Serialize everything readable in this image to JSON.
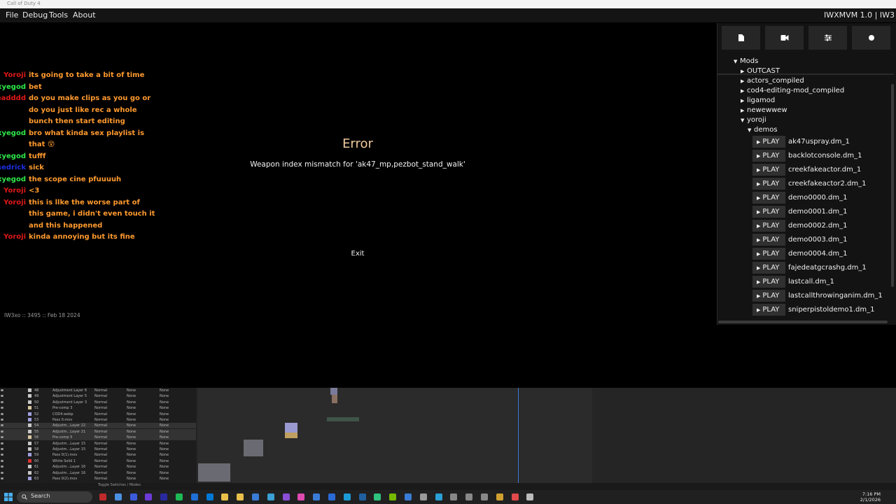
{
  "window": {
    "title": "Call of Duty 4"
  },
  "menu": {
    "file": "File",
    "debug": "Debug",
    "tools": "Tools",
    "about": "About",
    "version": "IWXMVM 1.0 | IW3"
  },
  "chat": [
    {
      "name": "Yoroji",
      "name_color": "#e01818",
      "text": "its going to take a bit of time"
    },
    {
      "name": "oxyegod",
      "name_color": "#2ee84a",
      "text": "bet"
    },
    {
      "name": "eadddd",
      "name_color": "#e01818",
      "text": "do you make clips as you go or"
    },
    {
      "name": "",
      "name_color": "#e01818",
      "text": "do you just like rec a whole"
    },
    {
      "name": "",
      "name_color": "#e01818",
      "text": "bunch then start editing"
    },
    {
      "name": "oxyegod",
      "name_color": "#2ee84a",
      "text": "bro what kinda sex playlist is"
    },
    {
      "name": "",
      "name_color": "#2ee84a",
      "text": "that 😵"
    },
    {
      "name": "oxyegod",
      "name_color": "#2ee84a",
      "text": "tufff"
    },
    {
      "name": "sedrick",
      "name_color": "#1b2ee0",
      "text": "sick"
    },
    {
      "name": "oxyegod",
      "name_color": "#2ee84a",
      "text": "the scope cine pfuuuuh"
    },
    {
      "name": "Yoroji",
      "name_color": "#e01818",
      "text": "<3"
    },
    {
      "name": "Yoroji",
      "name_color": "#e01818",
      "text": "this is llke the worse part of"
    },
    {
      "name": "",
      "name_color": "#e01818",
      "text": "this game, i didn't even touch it"
    },
    {
      "name": "",
      "name_color": "#e01818",
      "text": "and this happened"
    },
    {
      "name": "Yoroji",
      "name_color": "#e01818",
      "text": "kinda annoying but its fine"
    }
  ],
  "error": {
    "title": "Error",
    "message": "Weapon index mismatch for 'ak47_mp,pezbot_stand_walk'",
    "exit": "Exit"
  },
  "build": "IW3xo :: 3495 :: Feb 18 2024",
  "panel": {
    "toolbar": [
      "file-icon",
      "camera-icon",
      "sliders-icon",
      "record-icon"
    ],
    "tree": {
      "root": "Mods",
      "folders": [
        "OUTCAST",
        "actors_compiled",
        "cod4-editing-mod_compiled",
        "ligamod",
        "newewwew"
      ],
      "open_folder": "yoroji",
      "subfolder": "demos",
      "play_label": "PLAY",
      "demos": [
        "ak47uspray.dm_1",
        "backlotconsole.dm_1",
        "creekfakeactor.dm_1",
        "creekfakeactor2.dm_1",
        "demo0000.dm_1",
        "demo0001.dm_1",
        "demo0002.dm_1",
        "demo0003.dm_1",
        "demo0004.dm_1",
        "fajedeatgcrashg.dm_1",
        "lastcall.dm_1",
        "lastcallthrowinganim.dm_1",
        "sniperpistoldemo1.dm_1"
      ]
    }
  },
  "timeline": {
    "layers": [
      {
        "num": "48",
        "name": "Adjustment Layer 6",
        "mode": "Normal",
        "trk": "None",
        "parent": "None",
        "color": "#c8c8c8"
      },
      {
        "num": "49",
        "name": "Adjustment Layer 5",
        "mode": "Normal",
        "trk": "None",
        "parent": "None",
        "color": "#c8c8c8"
      },
      {
        "num": "50",
        "name": "Adjustment Layer 3",
        "mode": "Normal",
        "trk": "None",
        "parent": "None",
        "color": "#c8c8c8"
      },
      {
        "num": "51",
        "name": "Pre-comp 3",
        "mode": "Normal",
        "trk": "None",
        "parent": "None",
        "color": "#d8c8a0"
      },
      {
        "num": "52",
        "name": "COD4.webp",
        "mode": "Normal",
        "trk": "None",
        "parent": "None",
        "color": "#a0a0e0"
      },
      {
        "num": "53",
        "name": "Pass 0.mov",
        "mode": "Normal",
        "trk": "None",
        "parent": "None",
        "color": "#a0a0e0"
      },
      {
        "num": "54",
        "name": "Adjustm...Layer 22",
        "mode": "Normal",
        "trk": "None",
        "parent": "None",
        "color": "#c8c8c8"
      },
      {
        "num": "55",
        "name": "Adjustm...Layer 21",
        "mode": "Normal",
        "trk": "None",
        "parent": "None",
        "color": "#c8c8c8"
      },
      {
        "num": "56",
        "name": "Pre-comp 5",
        "mode": "Normal",
        "trk": "None",
        "parent": "None",
        "color": "#d8c8a0"
      },
      {
        "num": "57",
        "name": "Adjustm...Layer 15",
        "mode": "Normal",
        "trk": "None",
        "parent": "None",
        "color": "#c8c8c8"
      },
      {
        "num": "58",
        "name": "Adjustm...Layer 15",
        "mode": "Normal",
        "trk": "None",
        "parent": "None",
        "color": "#c8c8c8"
      },
      {
        "num": "59",
        "name": "Pass 0(1).mov",
        "mode": "Normal",
        "trk": "None",
        "parent": "None",
        "color": "#a0a0e0"
      },
      {
        "num": "60",
        "name": "White Solid 1",
        "mode": "Normal",
        "trk": "None",
        "parent": "None",
        "color": "#e03030"
      },
      {
        "num": "61",
        "name": "Adjustm...Layer 16",
        "mode": "Normal",
        "trk": "None",
        "parent": "None",
        "color": "#c8c8c8"
      },
      {
        "num": "62",
        "name": "Adjustm...Layer 16",
        "mode": "Normal",
        "trk": "None",
        "parent": "None",
        "color": "#c8c8c8"
      },
      {
        "num": "63",
        "name": "Pass 0(2).mov",
        "mode": "Normal",
        "trk": "None",
        "parent": "None",
        "color": "#a0a0e0"
      }
    ],
    "footer": "Toggle Switches / Modes"
  },
  "taskbar": {
    "search": "Search",
    "time": "7:16 PM",
    "date": "2/1/2026",
    "apps": [
      "#c02a2a",
      "#4a90e2",
      "#3b5bdb",
      "#6c3bd6",
      "#2a2aa0",
      "#1db954",
      "#1e6fd6",
      "#0078d4",
      "#e8c04a",
      "#e8c04a",
      "#3a7bd5",
      "#3aa0d5",
      "#8a4fd6",
      "#e04ab0",
      "#3a7bd5",
      "#2a6ad6",
      "#1b9bd6",
      "#2060a0",
      "#2ec27e",
      "#76b900",
      "#3a7bd5",
      "#9a9a9a",
      "#2aa0d6",
      "#888",
      "#888",
      "#888",
      "#d0a030",
      "#e04a4a",
      "#bbb"
    ]
  }
}
